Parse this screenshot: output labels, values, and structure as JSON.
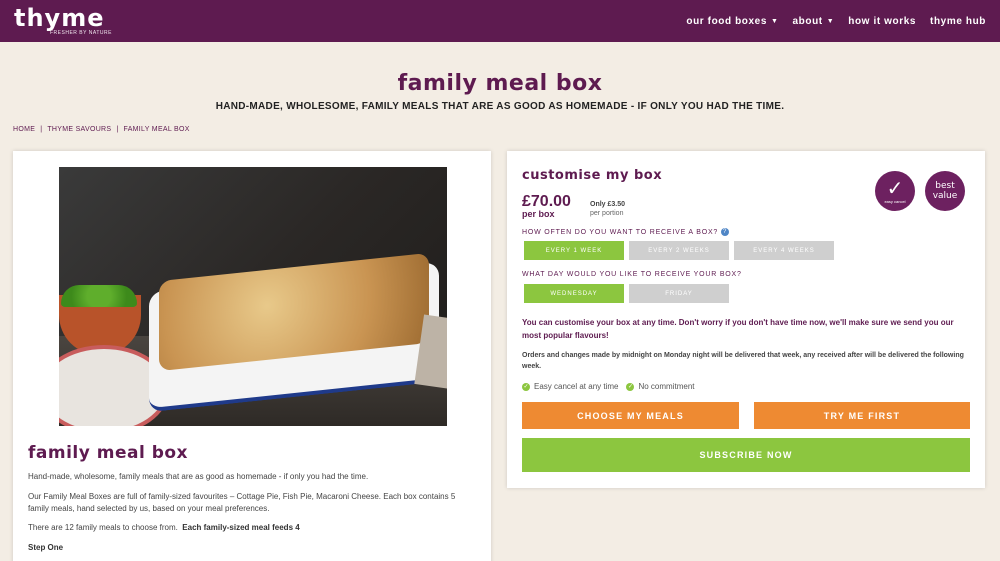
{
  "header": {
    "logo_text": "thyme",
    "logo_tagline": "FRESHER BY NATURE",
    "nav": [
      {
        "label": "our food boxes",
        "dropdown": true
      },
      {
        "label": "about",
        "dropdown": true
      },
      {
        "label": "how it works",
        "dropdown": false
      },
      {
        "label": "thyme hub",
        "dropdown": false
      }
    ]
  },
  "page": {
    "title": "family meal box",
    "subtitle": "HAND-MADE, WHOLESOME, FAMILY MEALS THAT ARE AS GOOD AS HOMEMADE - IF ONLY YOU HAD THE TIME.",
    "breadcrumb": [
      "HOME",
      "THYME SAVOURS",
      "FAMILY MEAL BOX"
    ],
    "breadcrumb_separator": "|"
  },
  "product": {
    "heading": "family meal box",
    "intro": "Hand-made, wholesome, family meals that are as good as homemade - if only you had the time.",
    "description": "Our Family Meal Boxes are full of family-sized favourites – Cottage Pie, Fish Pie, Macaroni Cheese.  Each box contains 5 family meals, hand selected by us, based on your meal preferences.",
    "count_text": "There are 12 family meals to choose from.",
    "feeds_text": "Each family-sized meal feeds 4",
    "step_label": "Step One"
  },
  "customise": {
    "title": "customise my box",
    "price": "£70.00",
    "per_box": "per box",
    "only_price": "Only £3.50",
    "per_portion": "per portion",
    "badge_cancel_text": "easy cancel",
    "badge_value_line1": "best",
    "badge_value_line2": "value",
    "frequency_question": "HOW OFTEN DO YOU WANT TO RECEIVE A BOX?",
    "frequency_options": [
      {
        "label": "EVERY 1 WEEK",
        "selected": true
      },
      {
        "label": "EVERY 2 WEEKS",
        "selected": false
      },
      {
        "label": "EVERY 4 WEEKS",
        "selected": false
      }
    ],
    "day_question": "WHAT DAY WOULD YOU LIKE TO RECEIVE YOUR BOX?",
    "day_options": [
      {
        "label": "WEDNESDAY",
        "selected": true
      },
      {
        "label": "FRIDAY",
        "selected": false
      }
    ],
    "note_purple": "You can customise your box at any time. Don't worry if you don't have time now, we'll make sure we send you our most popular flavours!",
    "note_grey": "Orders and changes made by midnight on Monday night will be delivered that week, any received after will be delivered the following week.",
    "benefit_1": "Easy cancel at any time",
    "benefit_2": "No commitment",
    "btn_choose": "CHOOSE MY MEALS",
    "btn_try": "TRY ME FIRST",
    "btn_subscribe": "SUBSCRIBE NOW"
  },
  "colors": {
    "brand_purple": "#5e1b50",
    "accent_green": "#8cc63f",
    "accent_orange": "#ee8a32",
    "background": "#f3ede4"
  }
}
